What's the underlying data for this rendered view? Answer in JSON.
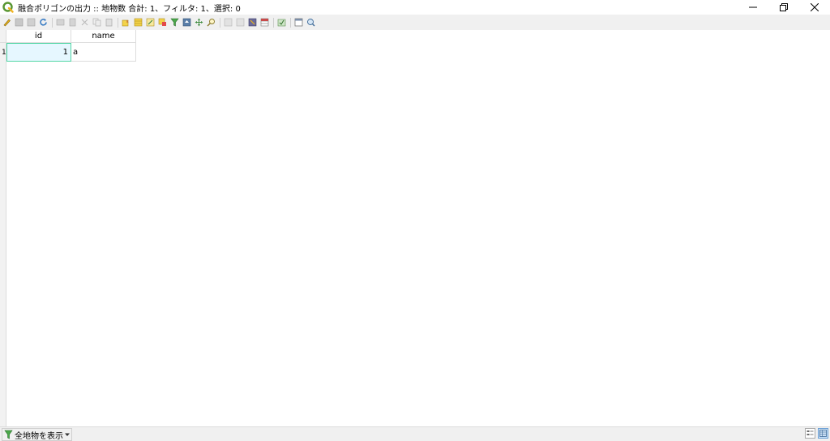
{
  "window": {
    "title": "融合ポリゴンの出力 :: 地物数 合計: 1、フィルタ: 1、選択: 0"
  },
  "toolbar": {
    "buttons": [
      "toggle-editing-icon",
      "save-edits-icon",
      "reload-icon",
      "refresh-icon",
      "add-feature-icon",
      "delete-feature-icon",
      "cut-icon",
      "copy-icon",
      "paste-icon",
      "select-expression-icon",
      "select-all-icon",
      "invert-selection-icon",
      "deselect-icon",
      "filter-icon",
      "move-selection-top-icon",
      "pan-to-selected-icon",
      "zoom-to-selected-icon",
      "new-field-icon",
      "delete-field-icon",
      "field-calculator-icon",
      "conditional-format-icon",
      "actions-icon",
      "dock-icon",
      "zoom-icon"
    ]
  },
  "table": {
    "columns": [
      "id",
      "name"
    ],
    "rows": [
      {
        "row_label": "1",
        "id": "1",
        "name": "a"
      }
    ]
  },
  "statusbar": {
    "filter_label": "全地物を表示"
  },
  "colors": {
    "selection_fill": "#e6f7ff",
    "selection_border": "#52d6a4",
    "qgis_green": "#589632",
    "toolbar_bg": "#f0f0f0"
  }
}
